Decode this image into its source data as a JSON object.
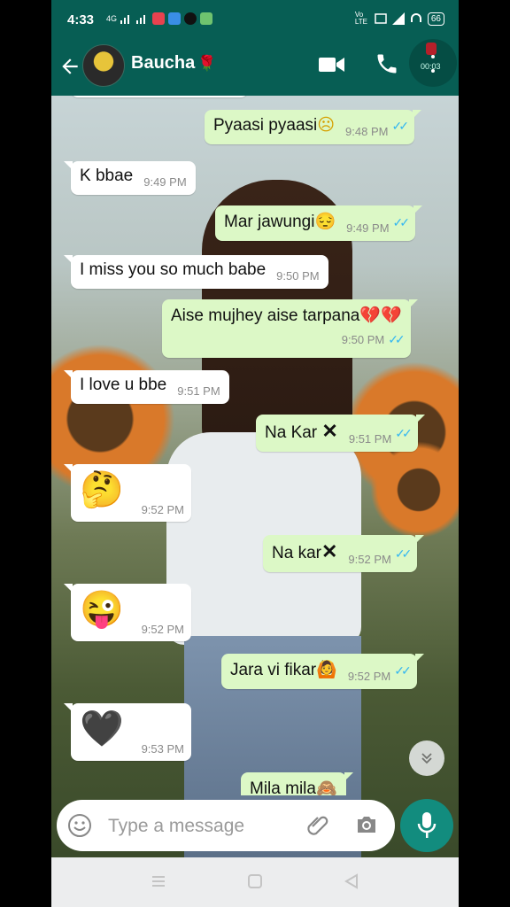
{
  "status": {
    "time": "4:33",
    "battery": "66",
    "volte": "Vo LTE",
    "signal": "4G"
  },
  "header": {
    "contact_name": "Baucha",
    "contact_emoji": "🌹",
    "record_time": "00:03"
  },
  "messages": [
    {
      "dir": "out",
      "text": "Pyaasi pyaasi",
      "emoji": "☹",
      "time": "9:48 PM",
      "ticks": "✓✓"
    },
    {
      "dir": "in",
      "text": "K bbae",
      "time": "9:49 PM"
    },
    {
      "dir": "out",
      "text": "Mar jawungi",
      "emoji": "😔",
      "time": "9:49 PM",
      "ticks": "✓✓"
    },
    {
      "dir": "in",
      "text": "I miss you so much babe",
      "time": "9:50 PM"
    },
    {
      "dir": "out",
      "text": "Aise mujhey aise tarpana",
      "emoji": "💔💔",
      "time": "9:50 PM",
      "ticks": "✓✓"
    },
    {
      "dir": "in",
      "text": "I love u bbe",
      "time": "9:51 PM"
    },
    {
      "dir": "out",
      "text": "Na Kar ",
      "emoji": "✕",
      "time": "9:51 PM",
      "ticks": "✓✓"
    },
    {
      "dir": "in",
      "emoji": "🤔",
      "time": "9:52 PM"
    },
    {
      "dir": "out",
      "text": "Na kar",
      "emoji": "✕",
      "time": "9:52 PM",
      "ticks": "✓✓"
    },
    {
      "dir": "in",
      "emoji": "😜",
      "time": "9:52 PM"
    },
    {
      "dir": "out",
      "text": "Jara vi fikar",
      "emoji": "🙆",
      "time": "9:52 PM",
      "ticks": "✓✓"
    },
    {
      "dir": "in",
      "emoji": "🖤",
      "time": "9:53 PM"
    },
    {
      "dir": "out",
      "text": "Mila mila",
      "emoji": "🙈"
    }
  ],
  "input": {
    "placeholder": "Type a message"
  },
  "colors": {
    "header": "#075e54",
    "outgoing": "#dcf8c6",
    "incoming": "#ffffff",
    "mic": "#128c7e",
    "ticks": "#34b7f1"
  }
}
